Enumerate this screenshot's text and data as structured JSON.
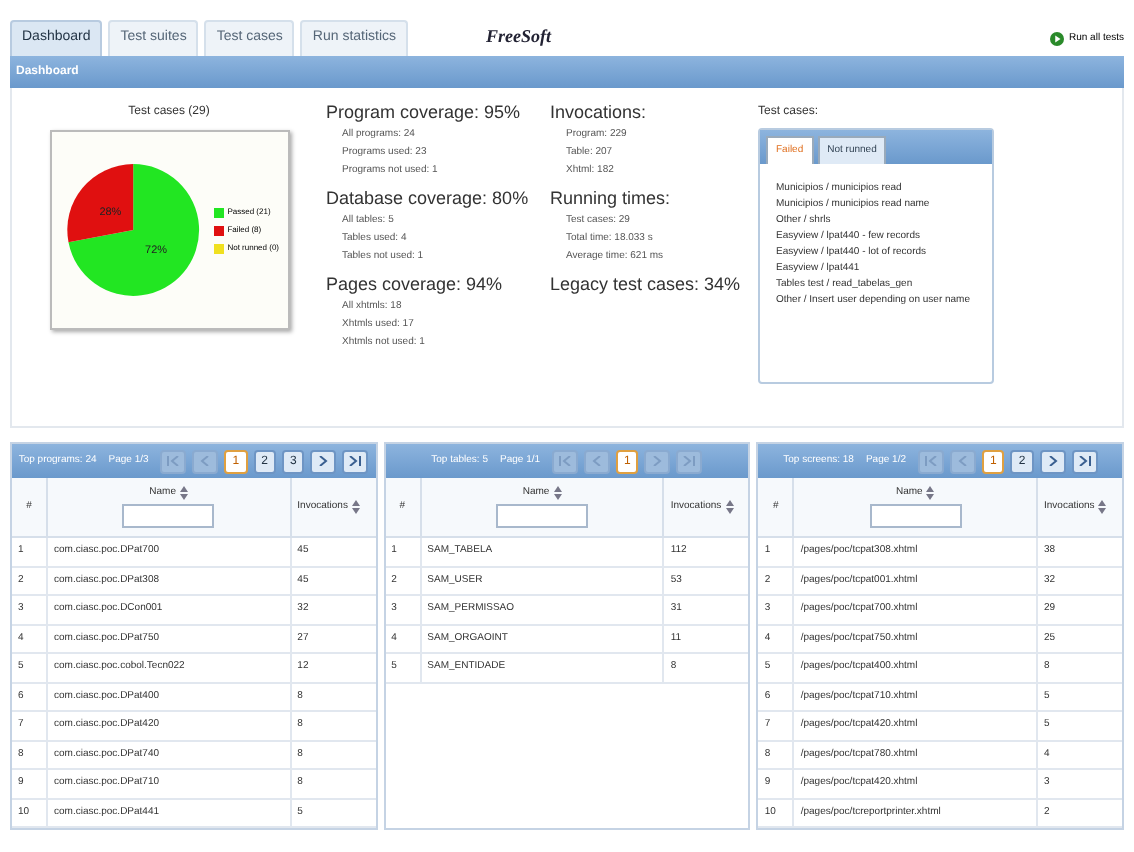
{
  "nav_tabs": [
    {
      "label": "Dashboard",
      "selected": true
    },
    {
      "label": "Test suites",
      "selected": false
    },
    {
      "label": "Test cases",
      "selected": false
    },
    {
      "label": "Run statistics",
      "selected": false
    }
  ],
  "logo": "FreeSoft",
  "run_all": "Run all tests",
  "title_bar": "Dashboard",
  "pie": {
    "title": "Test cases (29)",
    "chart_data": {
      "type": "pie",
      "categories": [
        "Passed (21)",
        "Failed (8)",
        "Not runned (0)"
      ],
      "values": [
        72,
        28,
        0
      ],
      "legend": "right",
      "colors": [
        "#22e622",
        "#e01010",
        "#f0e020"
      ],
      "value_labels": [
        "72%",
        "28%",
        null
      ]
    }
  },
  "stats_left": [
    {
      "title": "Program coverage: 95%",
      "lines": [
        "All programs: 24",
        "Programs used: 23",
        "Programs not used: 1"
      ]
    },
    {
      "title": "Database coverage: 80%",
      "lines": [
        "All tables: 5",
        "Tables used: 4",
        "Tables not used: 1"
      ]
    },
    {
      "title": "Pages coverage: 94%",
      "lines": [
        "All xhtmls: 18",
        "Xhtmls used: 17",
        "Xhtmls not used: 1"
      ]
    }
  ],
  "stats_right": [
    {
      "title": "Invocations:",
      "lines": [
        "Program: 229",
        "Table: 207",
        "Xhtml: 182"
      ]
    },
    {
      "title": "Running times:",
      "lines": [
        "Test cases: 29",
        "Total time: 18.033 s",
        "Average time: 621 ms"
      ]
    },
    {
      "title": "Legacy test cases: 34%"
    }
  ],
  "test_cases": {
    "title": "Test cases:",
    "tabs": [
      {
        "label": "Failed",
        "selected": true
      },
      {
        "label": "Not runned",
        "selected": false
      }
    ],
    "items": [
      "Municipios / municipios read",
      "Municipios / municipios read name",
      "Other / shrls",
      "Easyview / lpat440 - few records",
      "Easyview / lpat440 - lot of records",
      "Easyview / lpat441",
      "Tables test / read_tabelas_gen",
      "Other / Insert user depending on user name"
    ]
  },
  "tables": [
    {
      "summary": "Top programs: 24",
      "page": "Page 1/3",
      "pages": [
        {
          "label": "1",
          "selected": true
        },
        {
          "label": "2",
          "selected": false
        },
        {
          "label": "3",
          "selected": false
        }
      ],
      "columns": [
        "#",
        "Name",
        "Invocations"
      ],
      "rows": [
        [
          "1",
          "com.ciasc.poc.DPat700",
          "45"
        ],
        [
          "2",
          "com.ciasc.poc.DPat308",
          "45"
        ],
        [
          "3",
          "com.ciasc.poc.DCon001",
          "32"
        ],
        [
          "4",
          "com.ciasc.poc.DPat750",
          "27"
        ],
        [
          "5",
          "com.ciasc.poc.cobol.Tecn022",
          "12"
        ],
        [
          "6",
          "com.ciasc.poc.DPat400",
          "8"
        ],
        [
          "7",
          "com.ciasc.poc.DPat420",
          "8"
        ],
        [
          "8",
          "com.ciasc.poc.DPat740",
          "8"
        ],
        [
          "9",
          "com.ciasc.poc.DPat710",
          "8"
        ],
        [
          "10",
          "com.ciasc.poc.DPat441",
          "5"
        ]
      ]
    },
    {
      "summary": "Top tables: 5",
      "page": "Page 1/1",
      "pages": [
        {
          "label": "1",
          "selected": true
        }
      ],
      "columns": [
        "#",
        "Name",
        "Invocations"
      ],
      "rows": [
        [
          "1",
          "SAM_TABELA",
          "112"
        ],
        [
          "2",
          "SAM_USER",
          "53"
        ],
        [
          "3",
          "SAM_PERMISSAO",
          "31"
        ],
        [
          "4",
          "SAM_ORGAOINT",
          "11"
        ],
        [
          "5",
          "SAM_ENTIDADE",
          "8"
        ]
      ]
    },
    {
      "summary": "Top screens: 18",
      "page": "Page 1/2",
      "pages": [
        {
          "label": "1",
          "selected": true
        },
        {
          "label": "2",
          "selected": false
        }
      ],
      "columns": [
        "#",
        "Name",
        "Invocations"
      ],
      "rows": [
        [
          "1",
          "/pages/poc/tcpat308.xhtml",
          "38"
        ],
        [
          "2",
          "/pages/poc/tcpat001.xhtml",
          "32"
        ],
        [
          "3",
          "/pages/poc/tcpat700.xhtml",
          "29"
        ],
        [
          "4",
          "/pages/poc/tcpat750.xhtml",
          "25"
        ],
        [
          "5",
          "/pages/poc/tcpat400.xhtml",
          "8"
        ],
        [
          "6",
          "/pages/poc/tcpat710.xhtml",
          "5"
        ],
        [
          "7",
          "/pages/poc/tcpat420.xhtml",
          "5"
        ],
        [
          "8",
          "/pages/poc/tcpat780.xhtml",
          "4"
        ],
        [
          "9",
          "/pages/poc/tcpat420.xhtml",
          "3"
        ],
        [
          "10",
          "/pages/poc/tcreportprinter.xhtml",
          "2"
        ]
      ]
    }
  ]
}
